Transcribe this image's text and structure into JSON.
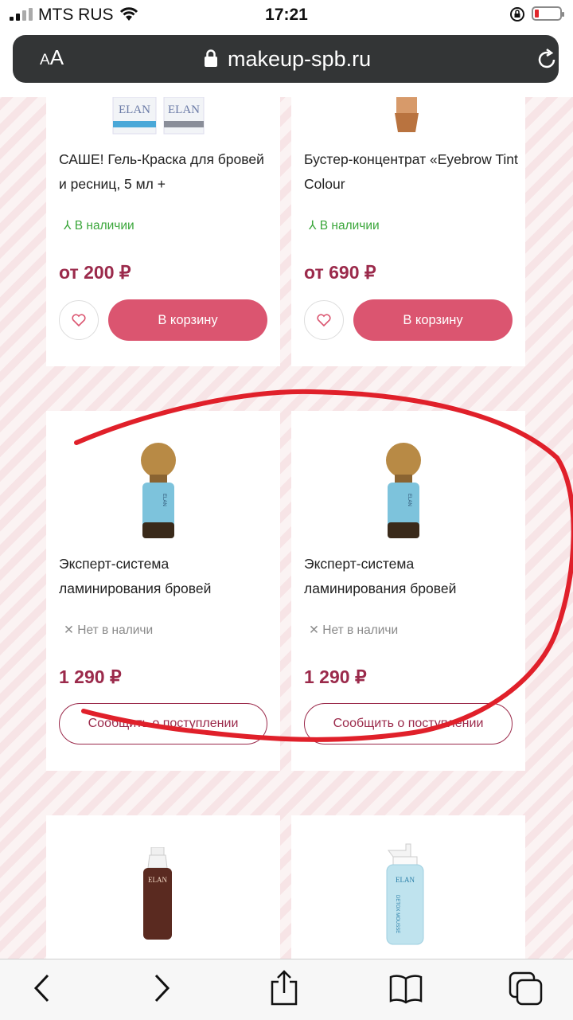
{
  "status_bar": {
    "carrier": "MTS RUS",
    "time": "17:21"
  },
  "browser": {
    "text_size_small": "A",
    "text_size_large": "A",
    "url": "makeup-spb.ru"
  },
  "products": [
    {
      "name": "САШЕ! Гель-Краска для бровей и ресниц, 5 мл +",
      "stock": "В наличии",
      "price": "от 200 ₽",
      "cart_label": "В корзину"
    },
    {
      "name": "Бустер-концентрат «Eyebrow Tint Colour",
      "stock": "В наличии",
      "price": "от 690 ₽",
      "cart_label": "В корзину"
    },
    {
      "name": "Эксперт-система ламинирования бровей",
      "stock": "Нет в наличи",
      "price": "1 290 ₽",
      "notify_label": "Сообщить о поступлении"
    },
    {
      "name": "Эксперт-система ламинирования бровей",
      "stock": "Нет в наличи",
      "price": "1 290 ₽",
      "notify_label": "Сообщить о поступлении"
    }
  ],
  "product_images": [
    "ELAN",
    "ELAN",
    "ELAN",
    "ELAN",
    "ELAN",
    "ELAN",
    "DETOX MOUSSE"
  ],
  "colors": {
    "accent": "#db5570",
    "price": "#9b2a4b",
    "in_stock": "#3aa63a",
    "annotation": "#e0202a"
  }
}
